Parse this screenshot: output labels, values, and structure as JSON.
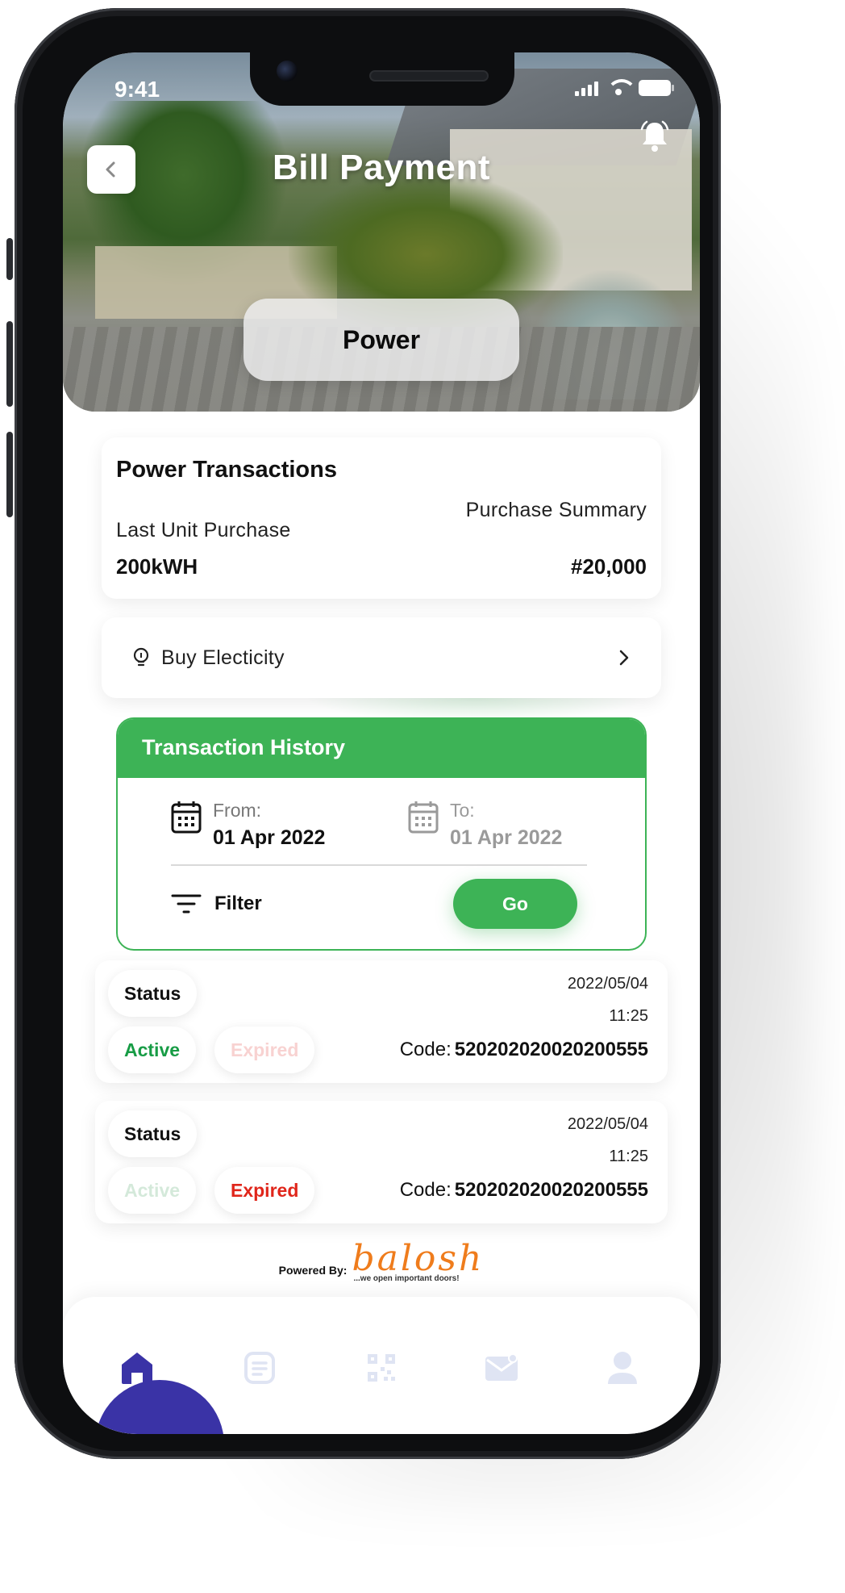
{
  "status_bar": {
    "time": "9:41"
  },
  "header": {
    "title": "Bill Payment",
    "tab_label": "Power"
  },
  "transactions_card": {
    "title": "Power Transactions",
    "purchase_summary_label": "Purchase Summary",
    "last_unit_label": "Last Unit Purchase",
    "last_unit_value": "200kWH",
    "summary_value": "#20,000"
  },
  "buy_electricity": {
    "label": "Buy Electicity"
  },
  "history": {
    "title": "Transaction History",
    "from_label": "From:",
    "from_value": "01 Apr 2022",
    "to_label": "To:",
    "to_value": "01 Apr 2022",
    "filter_label": "Filter",
    "go_label": "Go"
  },
  "rows": [
    {
      "status_label": "Status",
      "active_label": "Active",
      "expired_label": "Expired",
      "selected": "active",
      "date": "2022/05/04",
      "time": "11:25",
      "code_label": "Code:",
      "code_value": "520202020020200555"
    },
    {
      "status_label": "Status",
      "active_label": "Active",
      "expired_label": "Expired",
      "selected": "expired",
      "date": "2022/05/04",
      "time": "11:25",
      "code_label": "Code:",
      "code_value": "520202020020200555"
    }
  ],
  "footer": {
    "powered_by": "Powered By:",
    "brand": "balosh",
    "tagline": "...we open important doors!"
  },
  "colors": {
    "accent_green": "#3db356",
    "active_green": "#179c45",
    "expired_red": "#e0261b",
    "nav_active": "#3a33a6",
    "nav_inactive": "#dfe4f3"
  },
  "nav": [
    {
      "icon": "home-icon",
      "active": true
    },
    {
      "icon": "document-icon",
      "active": false
    },
    {
      "icon": "qr-code-icon",
      "active": false
    },
    {
      "icon": "mail-icon",
      "active": false
    },
    {
      "icon": "profile-icon",
      "active": false
    }
  ]
}
